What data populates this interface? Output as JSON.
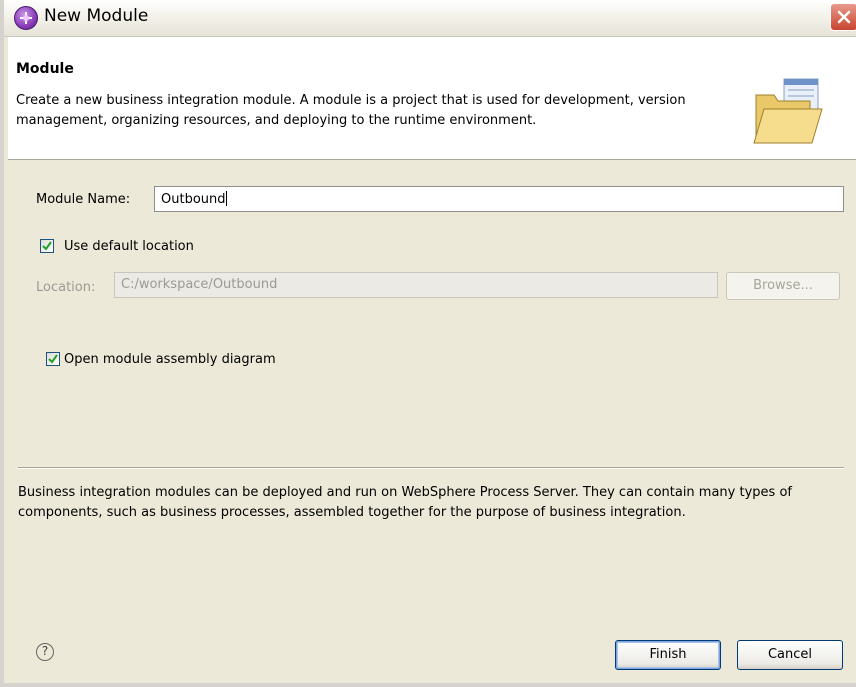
{
  "window": {
    "title": "New Module",
    "app_icon": "module-icon",
    "close_icon": "close-icon"
  },
  "banner": {
    "title": "Module",
    "description": "Create a new business integration module. A module is a project that is used for development, version management, organizing resources, and deploying to the runtime environment.",
    "icon": "open-folder-icon"
  },
  "form": {
    "module_name_label": "Module Name:",
    "module_name_value": "Outbound",
    "use_default_location_label": "Use default location",
    "use_default_location_checked": true,
    "location_label": "Location:",
    "location_value": "C:/workspace/Outbound",
    "browse_label": "Browse...",
    "open_diagram_label": "Open module assembly diagram",
    "open_diagram_checked": true
  },
  "footer": {
    "description": "Business integration modules can be deployed and run on WebSphere Process Server. They can contain many types of components, such as business processes, assembled together for the purpose of business integration.",
    "help_icon": "help-icon",
    "help_glyph": "?",
    "finish_label": "Finish",
    "cancel_label": "Cancel"
  },
  "colors": {
    "dialog_bg": "#ece9d8",
    "checkbox_check": "#21a121",
    "title_button_close": "#c8442e",
    "app_icon_purple": "#8a3bb8"
  }
}
